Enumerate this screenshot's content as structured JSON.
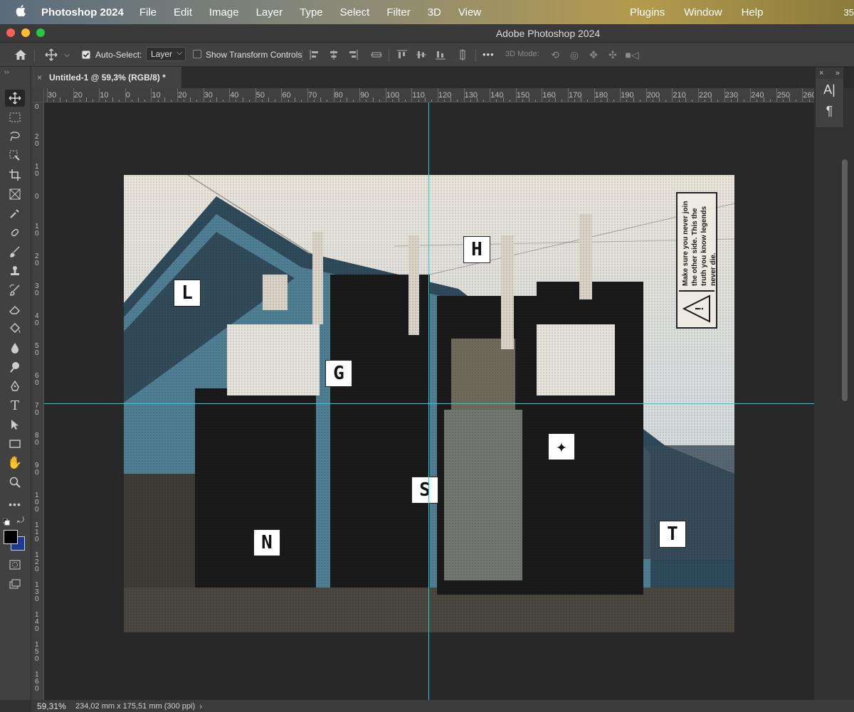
{
  "menubar": {
    "app_name": "Photoshop 2024",
    "items": [
      "File",
      "Edit",
      "Image",
      "Layer",
      "Type",
      "Select",
      "Filter",
      "3D",
      "View"
    ],
    "right_items": [
      "Plugins",
      "Window",
      "Help"
    ],
    "clock_fragment": "35"
  },
  "window": {
    "title": "Adobe Photoshop 2024"
  },
  "options_bar": {
    "auto_select_label": "Auto-Select:",
    "auto_select_checked": true,
    "auto_select_target": "Layer",
    "show_transform_label": "Show Transform Controls",
    "show_transform_checked": false,
    "more_label": "•••",
    "mode_3d_label": "3D Mode:"
  },
  "document_tab": {
    "close_glyph": "×",
    "title": "Untitled-1 @ 59,3% (RGB/8) *"
  },
  "ruler_h_labels": [
    "30",
    "20",
    "10",
    "0",
    "10",
    "20",
    "30",
    "40",
    "50",
    "60",
    "70",
    "80",
    "90",
    "100",
    "110",
    "120",
    "130",
    "140",
    "150",
    "160",
    "170",
    "180",
    "190",
    "200",
    "210",
    "220",
    "230",
    "240",
    "250",
    "260"
  ],
  "ruler_v_labels": [
    "0",
    "20",
    "10",
    "0",
    "10",
    "20",
    "30",
    "40",
    "50",
    "60",
    "70",
    "80",
    "90",
    "100",
    "110",
    "120",
    "130",
    "140",
    "150",
    "160"
  ],
  "artwork": {
    "letters": [
      "L",
      "G",
      "H",
      "✦",
      "S",
      "N",
      "T"
    ],
    "notice_text": "Make sure you never join the other side. This the truth you know legends never die.",
    "warning_glyph": "!"
  },
  "status": {
    "zoom": "59,31%",
    "doc_info": "234,02 mm x 175,51 mm (300 ppi)",
    "arrow": "›"
  },
  "panel": {
    "close_glyph": "×",
    "collapse_glyph": "»",
    "character_glyph": "A|",
    "paragraph_glyph": "¶"
  },
  "colors": {
    "guide": "#19d2db",
    "foreground": "#000000",
    "background": "#1f3a93"
  },
  "toolbar_icons": [
    "move-icon",
    "marquee-icon",
    "lasso-icon",
    "object-select-icon",
    "crop-icon",
    "frame-icon",
    "eyedropper-icon",
    "healing-brush-icon",
    "brush-icon",
    "clone-stamp-icon",
    "history-brush-icon",
    "eraser-icon",
    "paint-bucket-icon",
    "blur-icon",
    "dodge-icon",
    "pen-icon",
    "type-icon",
    "path-select-icon",
    "rectangle-icon",
    "hand-icon",
    "zoom-icon",
    "edit-toolbar-icon"
  ]
}
